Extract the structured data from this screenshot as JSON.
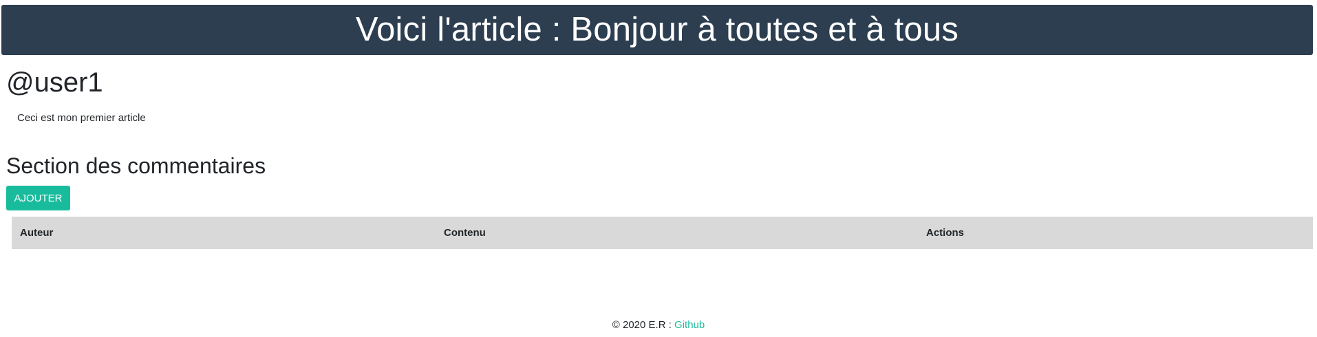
{
  "header": {
    "title": "Voici l'article : Bonjour à toutes et à tous"
  },
  "article": {
    "author": "@user1",
    "content": "Ceci est mon premier article"
  },
  "comments": {
    "heading": "Section des commentaires",
    "add_label": "AJOUTER",
    "table": {
      "columns": [
        "Auteur",
        "Contenu",
        "Actions"
      ],
      "rows": []
    }
  },
  "footer": {
    "copyright": "© 2020 E.R : ",
    "link_label": "Github"
  },
  "colors": {
    "header_bg": "#2c3e50",
    "accent": "#18bc9c",
    "table_header_bg": "#d9d9d9"
  }
}
